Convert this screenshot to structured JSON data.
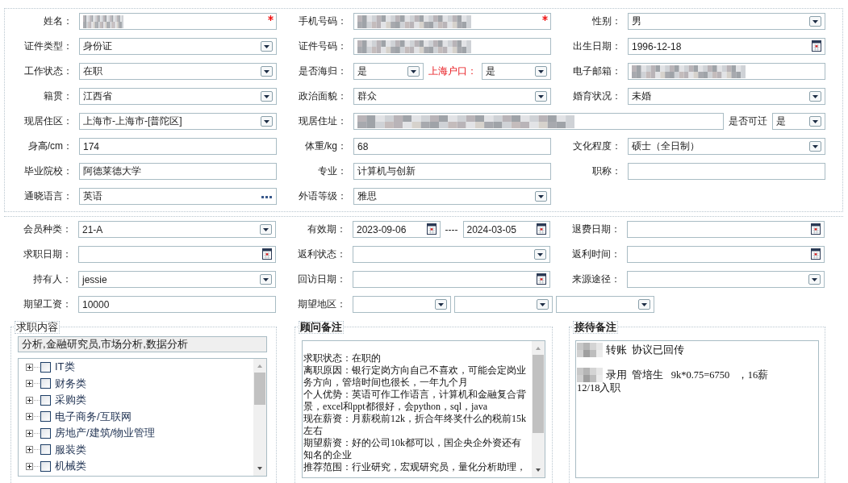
{
  "basic_info": {
    "rows": [
      {
        "groups": [
          {
            "label": "姓名：",
            "controls": [
              {
                "kind": "masked",
                "required": true
              }
            ]
          },
          {
            "label": "手机号码：",
            "controls": [
              {
                "kind": "masked",
                "required": true
              }
            ]
          },
          {
            "label": "性别：",
            "controls": [
              {
                "kind": "select",
                "value": "男"
              }
            ]
          }
        ]
      },
      {
        "groups": [
          {
            "label": "证件类型：",
            "controls": [
              {
                "kind": "select",
                "value": "身份证"
              }
            ]
          },
          {
            "label": "证件号码：",
            "controls": [
              {
                "kind": "masked"
              }
            ]
          },
          {
            "label": "出生日期：",
            "controls": [
              {
                "kind": "date",
                "value": "1996-12-18"
              }
            ]
          }
        ]
      },
      {
        "groups": [
          {
            "label": "工作状态：",
            "controls": [
              {
                "kind": "select",
                "value": "在职"
              }
            ]
          },
          {
            "label": "是否海归：",
            "controls": [
              {
                "kind": "select",
                "value": "是"
              },
              {
                "kind": "label",
                "text": "上海户口：",
                "highlight": true
              },
              {
                "kind": "select",
                "value": "是"
              }
            ]
          },
          {
            "label": "电子邮箱：",
            "controls": [
              {
                "kind": "masked"
              }
            ]
          }
        ]
      },
      {
        "groups": [
          {
            "label": "籍贯：",
            "controls": [
              {
                "kind": "select",
                "value": "江西省"
              }
            ]
          },
          {
            "label": "政治面貌：",
            "controls": [
              {
                "kind": "select",
                "value": "群众"
              }
            ]
          },
          {
            "label": "婚育状况：",
            "controls": [
              {
                "kind": "select",
                "value": "未婚"
              }
            ]
          }
        ]
      },
      {
        "groups": [
          {
            "label": "现居住区：",
            "controls": [
              {
                "kind": "select",
                "value": "上海市-上海市-[普陀区]"
              }
            ]
          },
          {
            "label": "现居住址：",
            "controls": [
              {
                "kind": "masked"
              },
              {
                "kind": "label",
                "text": "是否可迁",
                "highlight": false
              },
              {
                "kind": "select",
                "value": "是"
              }
            ]
          }
        ]
      },
      {
        "groups": [
          {
            "label": "身高/cm：",
            "controls": [
              {
                "kind": "text",
                "value": "174"
              }
            ]
          },
          {
            "label": "体重/kg：",
            "controls": [
              {
                "kind": "text",
                "value": "68"
              }
            ]
          },
          {
            "label": "文化程度：",
            "controls": [
              {
                "kind": "select",
                "value": "硕士（全日制）"
              }
            ]
          }
        ]
      },
      {
        "groups": [
          {
            "label": "毕业院校：",
            "controls": [
              {
                "kind": "text",
                "value": "阿德莱德大学"
              }
            ]
          },
          {
            "label": "专业：",
            "controls": [
              {
                "kind": "text",
                "value": "计算机与创新"
              }
            ]
          },
          {
            "label": "职称：",
            "controls": [
              {
                "kind": "text"
              }
            ]
          }
        ]
      },
      {
        "groups": [
          {
            "label": "通晓语言：",
            "controls": [
              {
                "kind": "lookup",
                "value": "英语"
              }
            ]
          },
          {
            "label": "外语等级：",
            "controls": [
              {
                "kind": "select",
                "value": "雅思"
              }
            ]
          }
        ]
      }
    ]
  },
  "membership": {
    "rows": [
      {
        "groups": [
          {
            "label": "会员种类：",
            "controls": [
              {
                "kind": "select",
                "value": "21-A"
              }
            ]
          },
          {
            "label": "有效期：",
            "controls": [
              {
                "kind": "date",
                "value": "2023-09-06"
              },
              {
                "kind": "separator",
                "text": "----"
              },
              {
                "kind": "date",
                "value": "2024-03-05"
              }
            ]
          },
          {
            "label": "退费日期：",
            "controls": [
              {
                "kind": "date"
              }
            ]
          }
        ]
      },
      {
        "groups": [
          {
            "label": "求职日期：",
            "controls": [
              {
                "kind": "date"
              }
            ]
          },
          {
            "label": "返利状态：",
            "controls": [
              {
                "kind": "select"
              }
            ]
          },
          {
            "label": "返利时间：",
            "controls": [
              {
                "kind": "date"
              }
            ]
          }
        ]
      },
      {
        "groups": [
          {
            "label": "持有人：",
            "controls": [
              {
                "kind": "select",
                "value": "jessie"
              }
            ]
          },
          {
            "label": "回访日期：",
            "controls": [
              {
                "kind": "date"
              }
            ]
          },
          {
            "label": "来源途径：",
            "controls": [
              {
                "kind": "select"
              }
            ]
          }
        ]
      },
      {
        "groups": [
          {
            "label": "期望工资：",
            "controls": [
              {
                "kind": "text",
                "value": "10000"
              }
            ]
          },
          {
            "label": "期望地区：",
            "controls": [
              {
                "kind": "select"
              },
              {
                "kind": "select"
              },
              {
                "kind": "select"
              }
            ]
          }
        ]
      }
    ]
  },
  "job_intent": {
    "legend": "求职内容",
    "filter_value": "分析,金融研究员,市场分析,数据分析",
    "categories": [
      {
        "label": "IT类",
        "expanded": false,
        "checked": false
      },
      {
        "label": "财务类",
        "expanded": false,
        "checked": false
      },
      {
        "label": "采购类",
        "expanded": false,
        "checked": false
      },
      {
        "label": "电子商务/互联网",
        "expanded": false,
        "checked": false
      },
      {
        "label": "房地产/建筑/物业管理",
        "expanded": false,
        "checked": false
      },
      {
        "label": "服装类",
        "expanded": false,
        "checked": false
      },
      {
        "label": "机械类",
        "expanded": false,
        "checked": false
      }
    ]
  },
  "consultant_notes": {
    "legend": "顾问备注",
    "lines": [
      "求职状态：在职的",
      "离职原因：银行定岗方向自己不喜欢，可能会定岗业",
      "务方向，管培时间也很长，一年九个月",
      "个人优势：英语可作工作语言，计算机和金融复合背",
      "景，excel和ppt都很好，会python，sql，java",
      "现在薪资：月薪税前12k，折合年终奖什么的税前15k",
      "左右",
      "期望薪资：好的公司10k都可以，国企央企外资还有",
      "知名的企业",
      "推荐范围：行业研究，宏观研究员，量化分析助理，"
    ]
  },
  "reception_notes": {
    "legend": "接待备注",
    "paragraphs": [
      {
        "lines": [
          {
            "masked": true,
            "text": "转账  协议已回传"
          }
        ]
      },
      {
        "lines": [
          {
            "masked": true,
            "text": "录用  管培生   9k*0.75=6750   ，16薪"
          },
          {
            "masked": false,
            "text": "12/18入职"
          }
        ]
      }
    ]
  }
}
